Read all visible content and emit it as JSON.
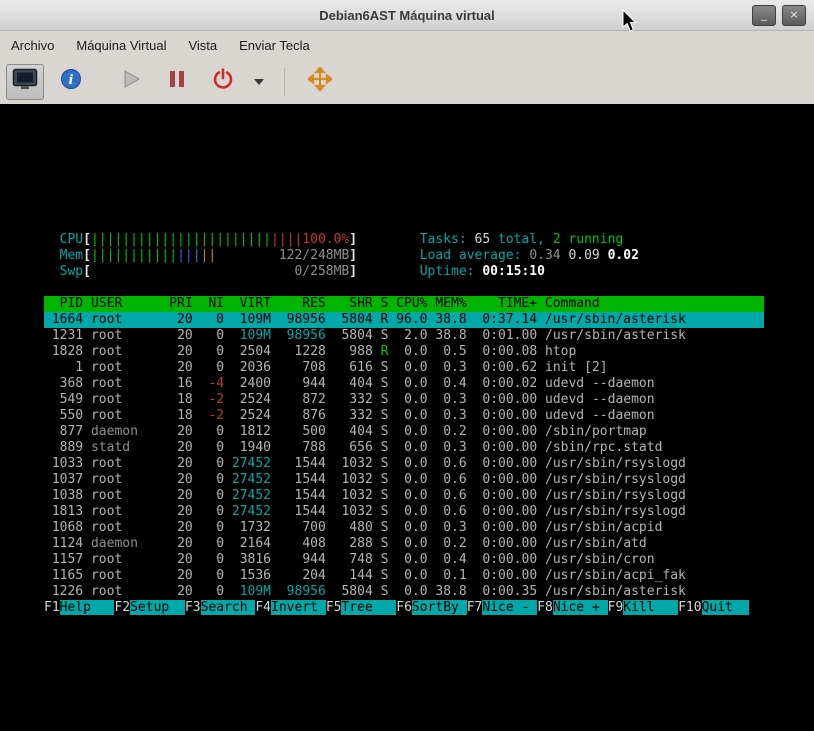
{
  "window": {
    "title": "Debian6AST Máquina virtual",
    "minimize_glyph": "_",
    "close_glyph": "×"
  },
  "menubar": {
    "items": [
      "Archivo",
      "Máquina Virtual",
      "Vista",
      "Enviar Tecla"
    ]
  },
  "toolbar": {
    "buttons": [
      {
        "name": "console-display-button",
        "icon": "monitor-icon"
      },
      {
        "name": "vm-info-button",
        "icon": "info-icon"
      },
      {
        "name": "run-button",
        "icon": "play-icon"
      },
      {
        "name": "pause-button",
        "icon": "pause-icon"
      },
      {
        "name": "shutdown-button",
        "icon": "power-icon"
      },
      {
        "name": "shutdown-menu-button",
        "icon": "chevron-down-icon"
      },
      {
        "name": "fullscreen-button",
        "icon": "move-arrows-icon"
      }
    ]
  },
  "htop": {
    "meters": [
      {
        "label": "CPU",
        "segments": [
          {
            "text": "|||||||||||||||||||||||",
            "color": "green"
          },
          {
            "text": "||||",
            "color": "red"
          }
        ],
        "value": "100.0%",
        "value_color": "red"
      },
      {
        "label": "Mem",
        "segments": [
          {
            "text": "|||||||||||",
            "color": "green"
          },
          {
            "text": "|||",
            "color": "blue"
          },
          {
            "text": "||",
            "color": "orange"
          }
        ],
        "value": "122/248MB",
        "value_color": "gray"
      },
      {
        "label": "Swp",
        "segments": [],
        "value": "0/258MB",
        "value_color": "gray"
      }
    ],
    "info": {
      "tasks_label": "Tasks: ",
      "tasks_count": "65",
      "tasks_sep": " total, ",
      "running_count": "2",
      "running_label": " running",
      "load_label": "Load average: ",
      "load_values": [
        "0.34",
        "0.09",
        "0.02"
      ],
      "uptime_label": "Uptime: ",
      "uptime_value": "00:15:10"
    },
    "columns": [
      "PID",
      "USER",
      "PRI",
      "NI",
      "VIRT",
      "RES",
      "SHR",
      "S",
      "CPU%",
      "MEM%",
      "TIME+",
      "Command"
    ],
    "selected_index": 0,
    "rows": [
      [
        "1664",
        "root",
        "20",
        "0",
        "109M",
        "98956",
        "5804",
        "R",
        "96.0",
        "38.8",
        "0:37.14",
        "/usr/sbin/asterisk"
      ],
      [
        "1231",
        "root",
        "20",
        "0",
        "109M",
        "98956",
        "5804",
        "S",
        "2.0",
        "38.8",
        "0:01.00",
        "/usr/sbin/asterisk"
      ],
      [
        "1828",
        "root",
        "20",
        "0",
        "2504",
        "1228",
        "988",
        "R",
        "0.0",
        "0.5",
        "0:00.08",
        "htop"
      ],
      [
        "1",
        "root",
        "20",
        "0",
        "2036",
        "708",
        "616",
        "S",
        "0.0",
        "0.3",
        "0:00.62",
        "init [2]"
      ],
      [
        "368",
        "root",
        "16",
        "-4",
        "2400",
        "944",
        "404",
        "S",
        "0.0",
        "0.4",
        "0:00.02",
        "udevd --daemon"
      ],
      [
        "549",
        "root",
        "18",
        "-2",
        "2524",
        "872",
        "332",
        "S",
        "0.0",
        "0.3",
        "0:00.00",
        "udevd --daemon"
      ],
      [
        "550",
        "root",
        "18",
        "-2",
        "2524",
        "876",
        "332",
        "S",
        "0.0",
        "0.3",
        "0:00.00",
        "udevd --daemon"
      ],
      [
        "877",
        "daemon",
        "20",
        "0",
        "1812",
        "500",
        "404",
        "S",
        "0.0",
        "0.2",
        "0:00.00",
        "/sbin/portmap"
      ],
      [
        "889",
        "statd",
        "20",
        "0",
        "1940",
        "788",
        "656",
        "S",
        "0.0",
        "0.3",
        "0:00.00",
        "/sbin/rpc.statd"
      ],
      [
        "1033",
        "root",
        "20",
        "0",
        "27452",
        "1544",
        "1032",
        "S",
        "0.0",
        "0.6",
        "0:00.00",
        "/usr/sbin/rsyslogd"
      ],
      [
        "1037",
        "root",
        "20",
        "0",
        "27452",
        "1544",
        "1032",
        "S",
        "0.0",
        "0.6",
        "0:00.00",
        "/usr/sbin/rsyslogd"
      ],
      [
        "1038",
        "root",
        "20",
        "0",
        "27452",
        "1544",
        "1032",
        "S",
        "0.0",
        "0.6",
        "0:00.00",
        "/usr/sbin/rsyslogd"
      ],
      [
        "1813",
        "root",
        "20",
        "0",
        "27452",
        "1544",
        "1032",
        "S",
        "0.0",
        "0.6",
        "0:00.00",
        "/usr/sbin/rsyslogd"
      ],
      [
        "1068",
        "root",
        "20",
        "0",
        "1732",
        "700",
        "480",
        "S",
        "0.0",
        "0.3",
        "0:00.00",
        "/usr/sbin/acpid"
      ],
      [
        "1124",
        "daemon",
        "20",
        "0",
        "2164",
        "408",
        "288",
        "S",
        "0.0",
        "0.2",
        "0:00.00",
        "/usr/sbin/atd"
      ],
      [
        "1157",
        "root",
        "20",
        "0",
        "3816",
        "944",
        "748",
        "S",
        "0.0",
        "0.4",
        "0:00.00",
        "/usr/sbin/cron"
      ],
      [
        "1165",
        "root",
        "20",
        "0",
        "1536",
        "204",
        "144",
        "S",
        "0.0",
        "0.1",
        "0:00.00",
        "/usr/sbin/acpi_fak"
      ],
      [
        "1226",
        "root",
        "20",
        "0",
        "109M",
        "98956",
        "5804",
        "S",
        "0.0",
        "38.8",
        "0:00.35",
        "/usr/sbin/asterisk"
      ]
    ],
    "fkeys": [
      {
        "key": "F1",
        "label": "Help   "
      },
      {
        "key": "F2",
        "label": "Setup  "
      },
      {
        "key": "F3",
        "label": "Search "
      },
      {
        "key": "F4",
        "label": "Invert "
      },
      {
        "key": "F5",
        "label": "Tree   "
      },
      {
        "key": "F6",
        "label": "SortBy "
      },
      {
        "key": "F7",
        "label": "Nice - "
      },
      {
        "key": "F8",
        "label": "Nice + "
      },
      {
        "key": "F9",
        "label": "Kill   "
      },
      {
        "key": "F10",
        "label": "Quit  "
      }
    ],
    "colors": {
      "header_bg": "#00b400",
      "selected_bg": "#00a8a8",
      "cyan": "#00a8a8",
      "green": "#00c400",
      "red": "#c2372a"
    }
  }
}
